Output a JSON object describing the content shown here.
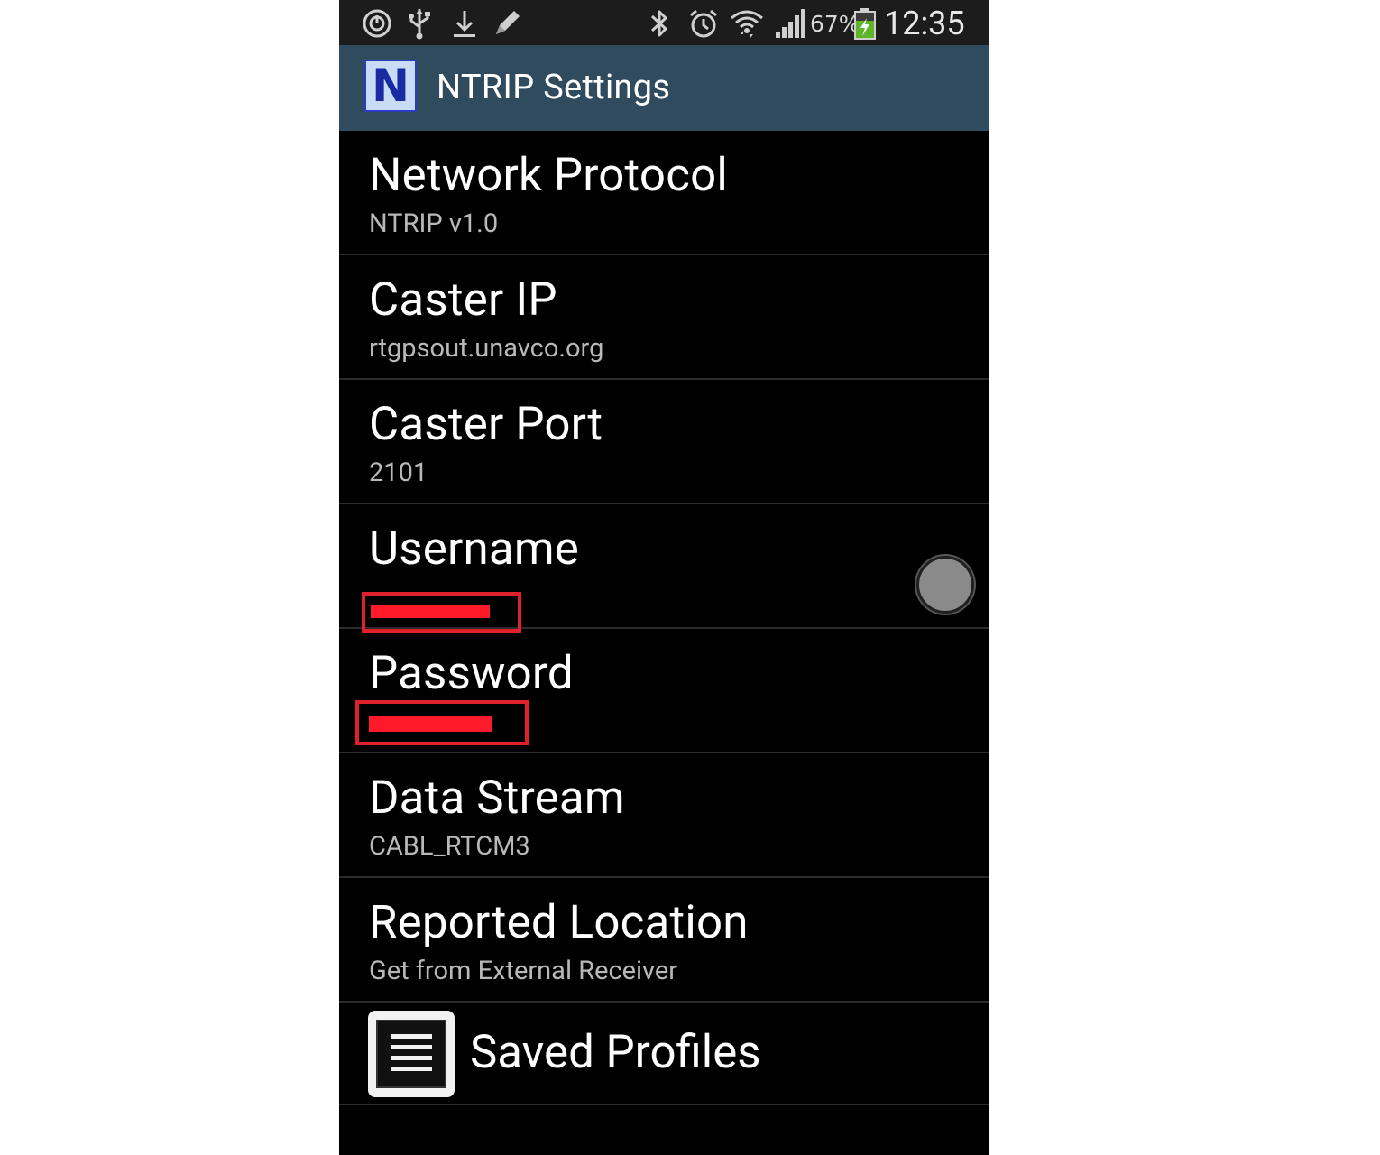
{
  "status_bar": {
    "icons": [
      "sync-icon",
      "usb-icon",
      "download-icon",
      "edit-icon",
      "bluetooth-icon",
      "alarm-icon",
      "wifi-icon",
      "signal-icon",
      "battery-charging-icon"
    ],
    "battery_percent": "67%",
    "time": "12:35"
  },
  "action_bar": {
    "logo_letter": "N",
    "title": "NTRIP Settings"
  },
  "preferences": [
    {
      "title": "Network Protocol",
      "summary": "NTRIP v1.0"
    },
    {
      "title": "Caster IP",
      "summary": "rtgpsout.unavco.org"
    },
    {
      "title": "Caster Port",
      "summary": "2101"
    },
    {
      "title": "Username",
      "summary": "",
      "redacted": true
    },
    {
      "title": "Password",
      "summary": "",
      "redacted": true
    },
    {
      "title": "Data Stream",
      "summary": "CABL_RTCM3"
    },
    {
      "title": "Reported Location",
      "summary": "Get from External Receiver"
    }
  ],
  "saved_profiles": {
    "label": "Saved Profiles",
    "icon": "list-icon"
  },
  "colors": {
    "action_bar": "#304b5e",
    "background": "#000000",
    "redaction": "#ff1a2a"
  }
}
